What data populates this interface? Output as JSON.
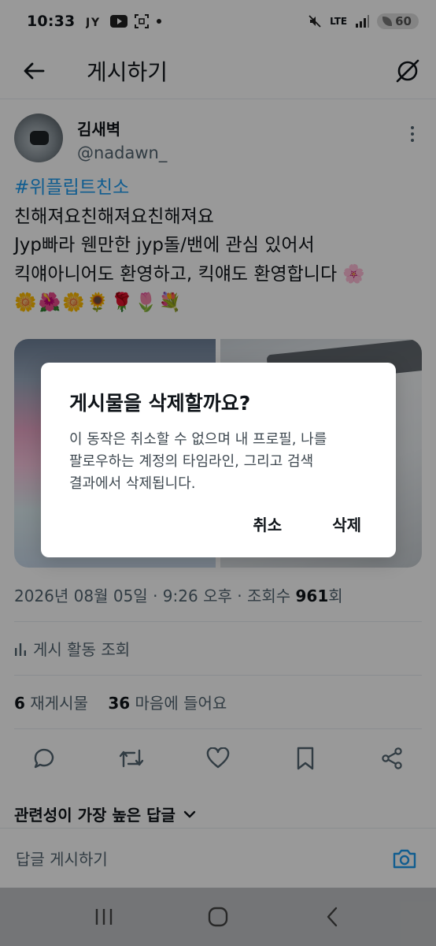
{
  "status_bar": {
    "time": "10:33",
    "battery": "60",
    "network": "LTE"
  },
  "header": {
    "title": "게시하기"
  },
  "tweet": {
    "author_name": "김새벽",
    "author_handle": "@nadawn_",
    "hashtag": "#위플립트친소",
    "line1": "친해져요친해져요친해져요",
    "line2": "Jyp빠라 웬만한 jyp돌/밴에 관심 있어서",
    "line3": "킥얘아니어도 환영하고, 킥얘도 환영합니다 🌸",
    "emoji_line": "🌼🌺🌼🌻🌹🌷💐",
    "date": "2026년 08월 05일",
    "time": "9:26 오후",
    "views_label": "조회수",
    "views_count": "961",
    "views_unit": "회",
    "activity_label": "게시 활동 조회",
    "retweets_count": "6",
    "retweets_label": "재게시물",
    "likes_count": "36",
    "likes_label": "마음에 들어요"
  },
  "replies": {
    "sort_label": "관련성이 가장 높은 답글",
    "placeholder": "답글 게시하기"
  },
  "dialog": {
    "title": "게시물을 삭제할까요?",
    "message_line1": "이 동작은 취소할 수 없으며 내 프로필, 나를",
    "message_line2": "팔로우하는 계정의 타임라인, 그리고 검색",
    "message_line3": "결과에서 삭제됩니다.",
    "cancel_label": "취소",
    "delete_label": "삭제"
  },
  "colors": {
    "accent": "#1d9bf0",
    "text": "#0f1419",
    "secondary_text": "#536471"
  }
}
